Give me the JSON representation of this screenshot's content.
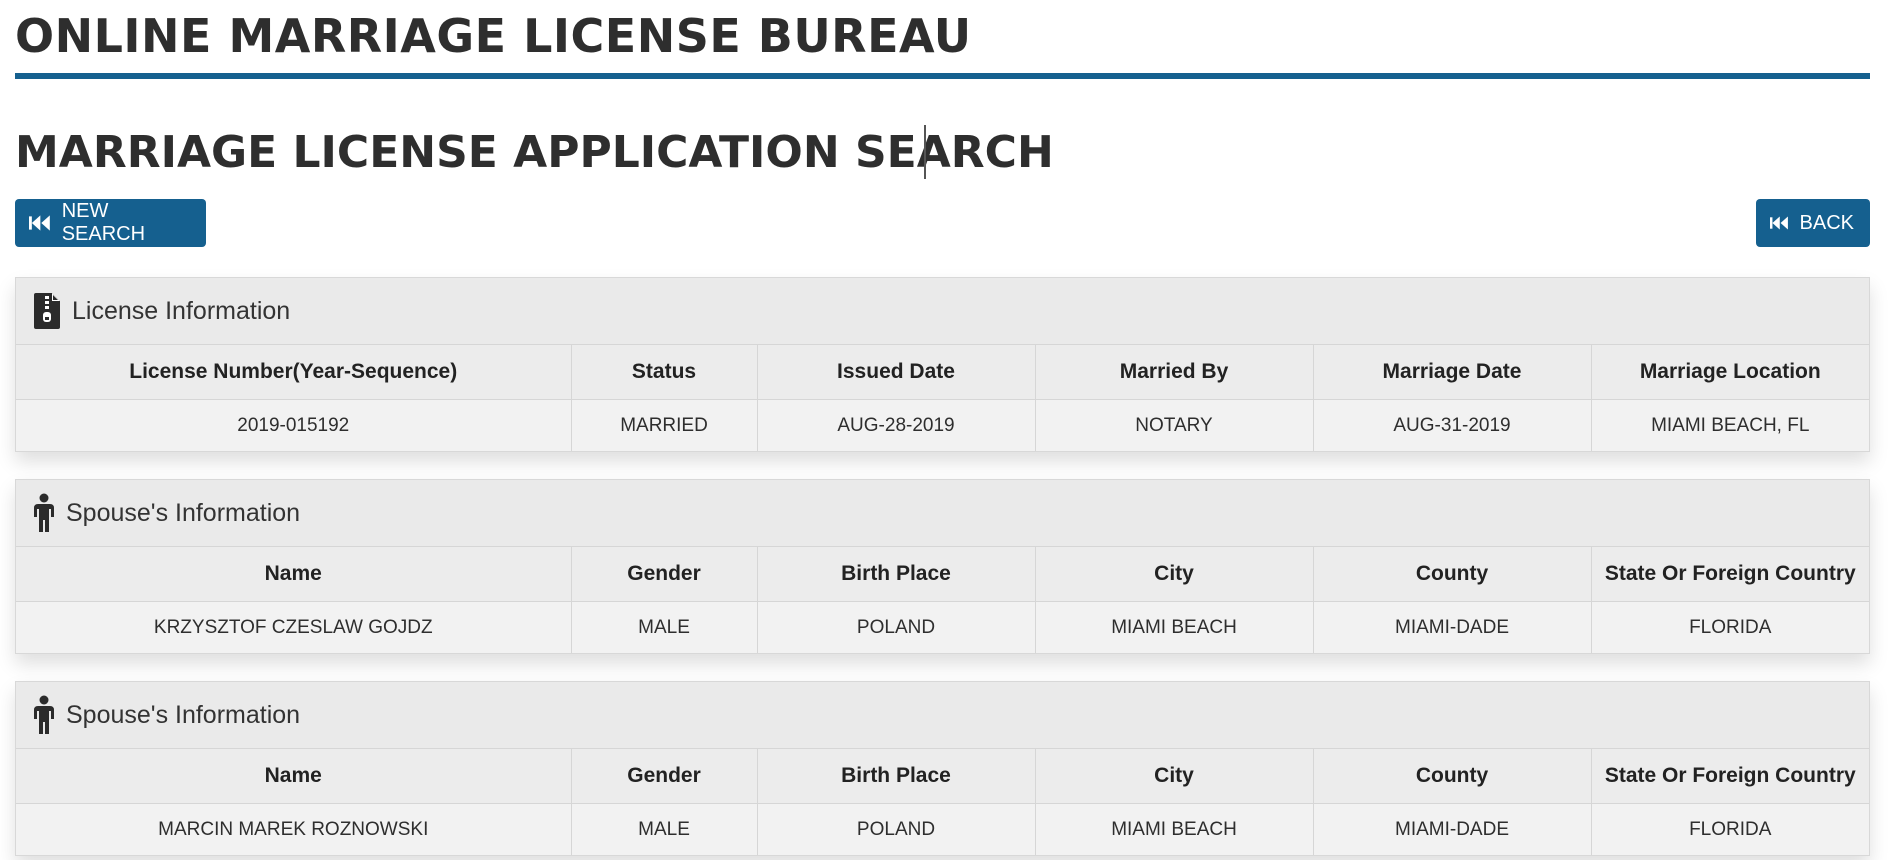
{
  "header": {
    "bureau_title": "ONLINE MARRIAGE LICENSE BUREAU",
    "page_title": "MARRIAGE LICENSE APPLICATION SEARCH"
  },
  "toolbar": {
    "new_search_label": "NEW SEARCH",
    "back_label": "BACK"
  },
  "license_panel": {
    "title": "License Information",
    "icon": "license-document-icon",
    "columns": [
      "License Number(Year-Sequence)",
      "Status",
      "Issued Date",
      "Married By",
      "Marriage Date",
      "Marriage Location"
    ],
    "row": [
      "2019-015192",
      "MARRIED",
      "AUG-28-2019",
      "NOTARY",
      "AUG-31-2019",
      "MIAMI BEACH, FL"
    ]
  },
  "spouses": [
    {
      "title": "Spouse's Information",
      "icon": "person-icon",
      "columns": [
        "Name",
        "Gender",
        "Birth Place",
        "City",
        "County",
        "State Or Foreign Country"
      ],
      "row": [
        "KRZYSZTOF CZESLAW GOJDZ",
        "MALE",
        "POLAND",
        "MIAMI BEACH",
        "MIAMI-DADE",
        "FLORIDA"
      ]
    },
    {
      "title": "Spouse's Information",
      "icon": "person-icon",
      "columns": [
        "Name",
        "Gender",
        "Birth Place",
        "City",
        "County",
        "State Or Foreign Country"
      ],
      "row": [
        "MARCIN MAREK ROZNOWSKI",
        "MALE",
        "POLAND",
        "MIAMI BEACH",
        "MIAMI-DADE",
        "FLORIDA"
      ]
    }
  ],
  "colors": {
    "accent": "#15608f",
    "panel_bg": "#eaeaea",
    "title_text": "#2e2e2e"
  }
}
